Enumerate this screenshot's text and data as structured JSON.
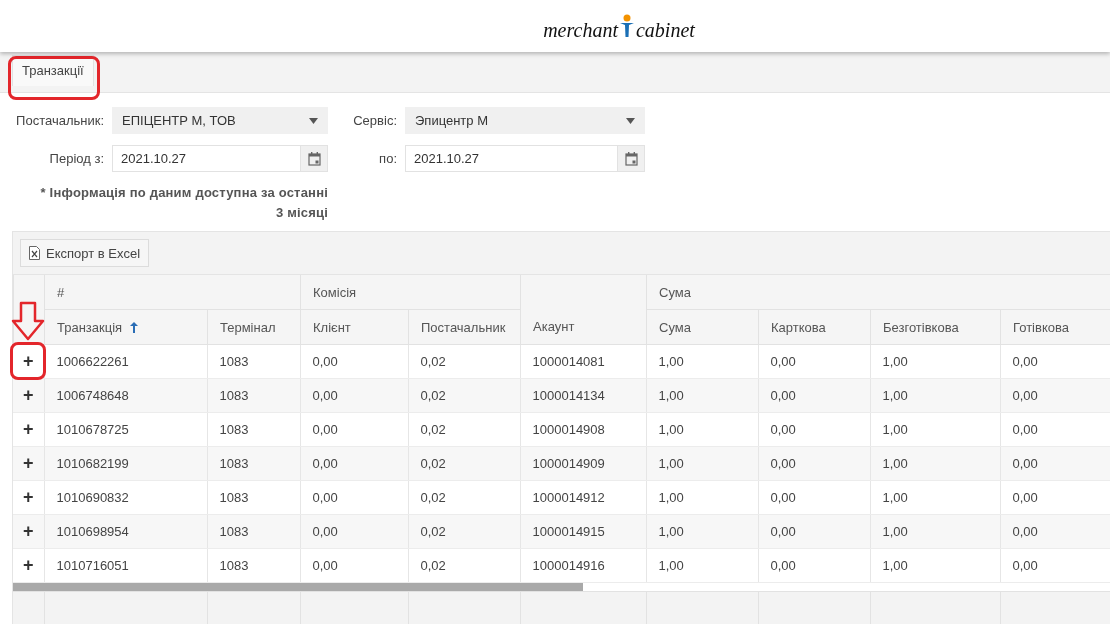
{
  "header": {
    "logo": {
      "left": "merchant",
      "right": "cabinet"
    }
  },
  "tabs": [
    {
      "label": "Транзакції",
      "selected": true
    }
  ],
  "filters": [
    {
      "kind": "select",
      "label": "Постачальник:",
      "value": "ЕПІЦЕНТР М, ТОВ"
    },
    {
      "kind": "select",
      "label": "Сервіс:",
      "value": "Эпицентр М"
    },
    {
      "kind": "date",
      "label": "Період з:",
      "value": "2021.10.27"
    },
    {
      "kind": "date",
      "label": "по:",
      "value": "2021.10.27"
    }
  ],
  "note": "* Інформація по даним доступна за останні 3 місяці",
  "toolbar": {
    "export_button": "Експорт в Excel"
  },
  "table": {
    "groups": [
      {
        "label": "#",
        "columns": [
          {
            "label": "Транзакція",
            "sorted": true
          },
          {
            "label": "Термінал"
          }
        ]
      },
      {
        "label": "Комісія",
        "columns": [
          {
            "label": "Клієнт"
          },
          {
            "label": "Постачальник"
          }
        ]
      },
      {
        "columns": [
          {
            "label": "Акаунт"
          }
        ]
      },
      {
        "label": "Сума",
        "columns": [
          {
            "label": "Сума"
          },
          {
            "label": "Карткова"
          },
          {
            "label": "Безготівкова"
          },
          {
            "label": "Готівкова"
          }
        ]
      }
    ],
    "rows": [
      {
        "expand": "+",
        "cells": [
          "1006622261",
          "1083",
          "0,00",
          "0,02",
          "1000014081",
          "1,00",
          "0,00",
          "1,00",
          "0,00"
        ]
      },
      {
        "expand": "+",
        "cells": [
          "1006748648",
          "1083",
          "0,00",
          "0,02",
          "1000014134",
          "1,00",
          "0,00",
          "1,00",
          "0,00"
        ]
      },
      {
        "expand": "+",
        "cells": [
          "1010678725",
          "1083",
          "0,00",
          "0,02",
          "1000014908",
          "1,00",
          "0,00",
          "1,00",
          "0,00"
        ]
      },
      {
        "expand": "+",
        "cells": [
          "1010682199",
          "1083",
          "0,00",
          "0,02",
          "1000014909",
          "1,00",
          "0,00",
          "1,00",
          "0,00"
        ]
      },
      {
        "expand": "+",
        "cells": [
          "1010690832",
          "1083",
          "0,00",
          "0,02",
          "1000014912",
          "1,00",
          "0,00",
          "1,00",
          "0,00"
        ]
      },
      {
        "expand": "+",
        "cells": [
          "1010698954",
          "1083",
          "0,00",
          "0,02",
          "1000014915",
          "1,00",
          "0,00",
          "1,00",
          "0,00"
        ]
      },
      {
        "expand": "+",
        "cells": [
          "1010716051",
          "1083",
          "0,00",
          "0,02",
          "1000014916",
          "1,00",
          "0,00",
          "1,00",
          "0,00"
        ]
      }
    ]
  }
}
